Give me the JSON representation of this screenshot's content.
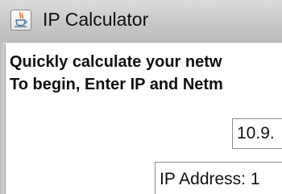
{
  "window": {
    "title": "IP Calculator",
    "icon": "java-coffee-cup-icon"
  },
  "intro": {
    "line1": "Quickly calculate your netw",
    "line2": "To begin, Enter IP and Netm"
  },
  "ip_input": {
    "value": "10.9."
  },
  "result": {
    "line1": "IP Address: 1"
  }
}
